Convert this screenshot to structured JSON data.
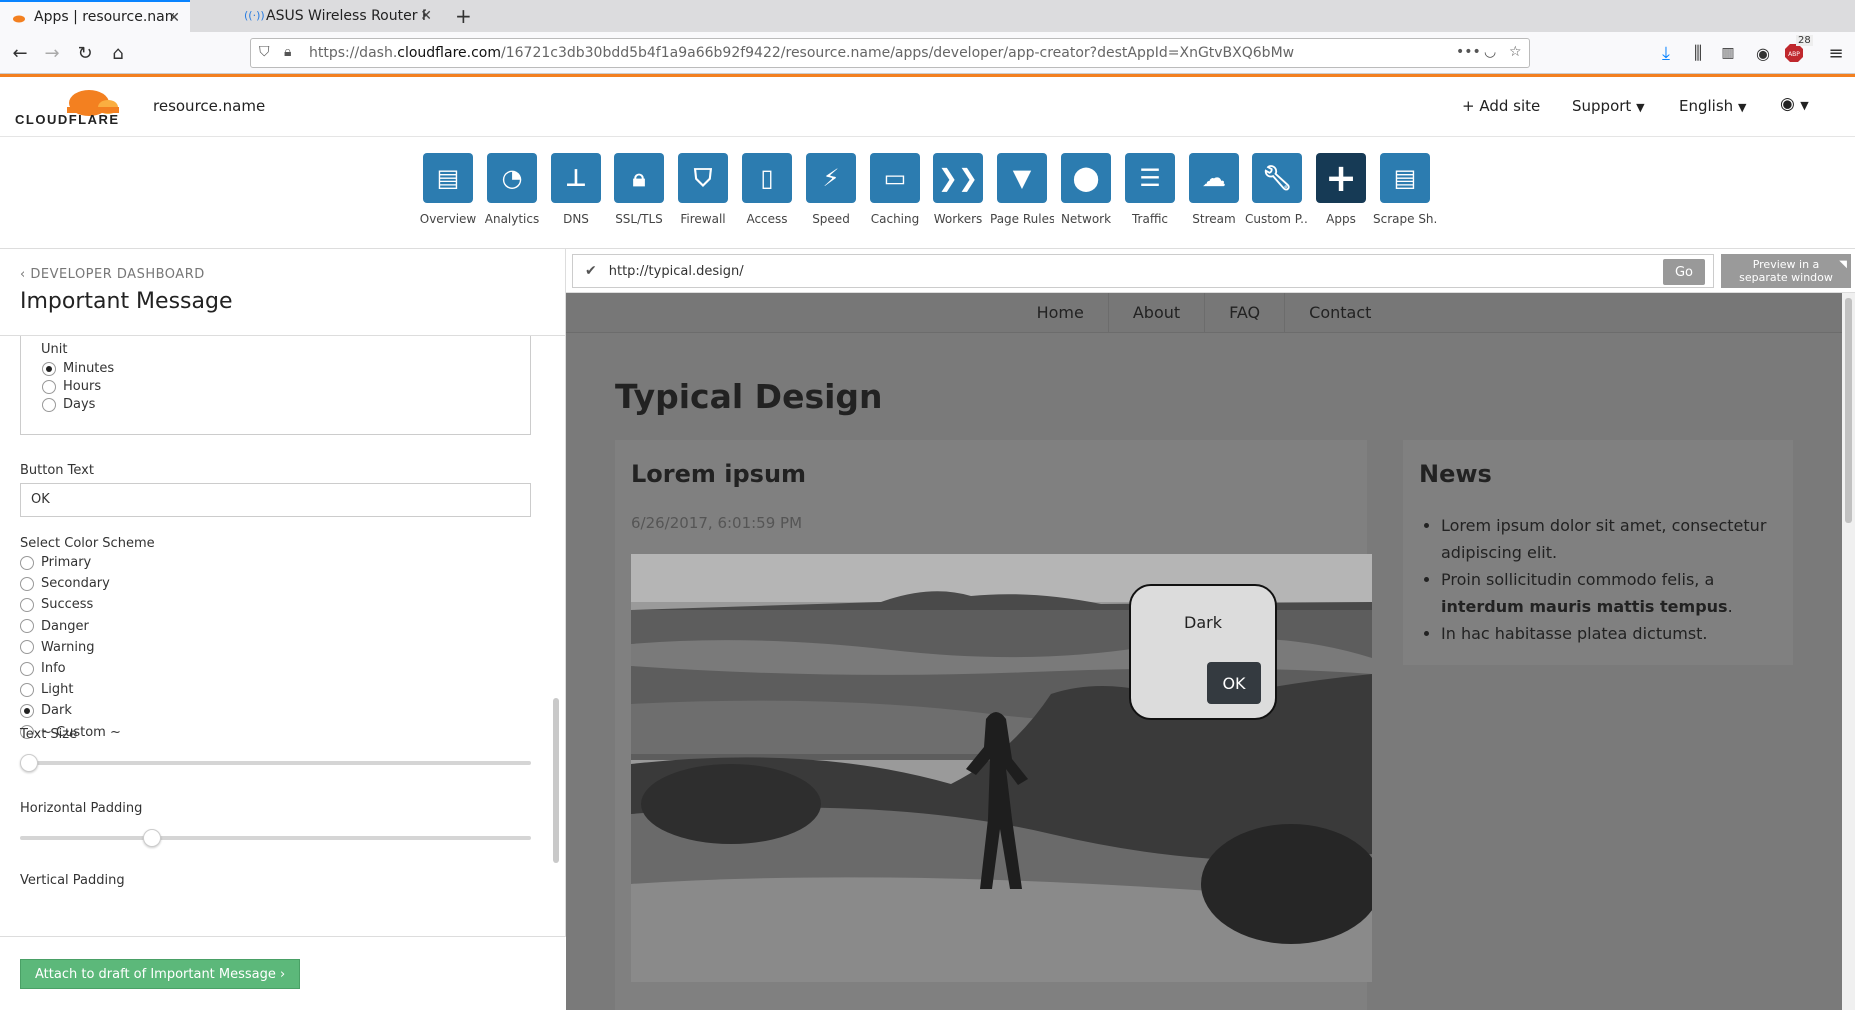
{
  "browser": {
    "tabs": [
      {
        "label": "Apps | resource.name | ⁄"
      },
      {
        "label": "ASUS Wireless Router RT"
      }
    ],
    "url_prefix": "https://dash.",
    "url_host": "cloudflare.com",
    "url_path": "/16721c3db30bdd5b4f1a9a66b92f9422/resource.name/apps/developer/app-creator?destAppId=XnGtvBXQ6bMw",
    "ext_badge": "28"
  },
  "header": {
    "logo_text": "CLOUDFLARE",
    "domain": "resource.name",
    "add_site": "+ Add site",
    "support": "Support",
    "language": "English"
  },
  "apps": [
    {
      "label": "Overview",
      "icon": "clipboard-icon"
    },
    {
      "label": "Analytics",
      "icon": "pie-chart-icon"
    },
    {
      "label": "DNS",
      "icon": "network-tree-icon"
    },
    {
      "label": "SSL/TLS",
      "icon": "lock-icon"
    },
    {
      "label": "Firewall",
      "icon": "shield-icon"
    },
    {
      "label": "Access",
      "icon": "door-icon"
    },
    {
      "label": "Speed",
      "icon": "lightning-icon"
    },
    {
      "label": "Caching",
      "icon": "drive-icon"
    },
    {
      "label": "Workers",
      "icon": "workers-icon"
    },
    {
      "label": "Page Rules",
      "icon": "filter-icon"
    },
    {
      "label": "Network",
      "icon": "location-pin-icon"
    },
    {
      "label": "Traffic",
      "icon": "list-icon"
    },
    {
      "label": "Stream",
      "icon": "cloud-play-icon"
    },
    {
      "label": "Custom P...",
      "icon": "wrench-icon"
    },
    {
      "label": "Apps",
      "icon": "plus-icon"
    },
    {
      "label": "Scrape Sh...",
      "icon": "document-icon"
    }
  ],
  "panel": {
    "breadcrumb": "DEVELOPER DASHBOARD",
    "title": "Important Message",
    "unit_label": "Unit",
    "units": [
      "Minutes",
      "Hours",
      "Days"
    ],
    "unit_selected": "Minutes",
    "button_text_label": "Button Text",
    "button_text_value": "OK",
    "color_scheme_label": "Select Color Scheme",
    "color_schemes": [
      "Primary",
      "Secondary",
      "Success",
      "Danger",
      "Warning",
      "Info",
      "Light",
      "Dark",
      "~ Custom ~"
    ],
    "color_scheme_selected": "Dark",
    "text_size_label": "Text Size",
    "text_size_level": 0,
    "h_padding_label": "Horizontal Padding",
    "h_padding_level": 0.25,
    "v_padding_label": "Vertical Padding",
    "attach_button": "Attach to draft of Important Message ›"
  },
  "preview": {
    "url": "http://typical.design/",
    "go": "Go",
    "separate_window": "Preview in a separate window"
  },
  "site": {
    "nav": [
      "Home",
      "About",
      "FAQ",
      "Contact"
    ],
    "title": "Typical Design",
    "post_title": "Lorem ipsum",
    "post_date": "6/26/2017, 6:01:59 PM",
    "news_title": "News",
    "news_1": "Lorem ipsum dolor sit amet, consectetur adipiscing elit.",
    "news_2_pre": "Proin sollicitudin commodo felis, a ",
    "news_2_bold": "interdum mauris mattis tempus",
    "news_2_post": ".",
    "news_3": "In hac habitasse platea dictumst.",
    "modal_text": "Dark",
    "modal_button": "OK"
  },
  "colors": {
    "accent": "#2c7cb0",
    "active_tile": "#163a55",
    "cf_orange": "#f38020",
    "attach_green": "#5cb87a",
    "dark_button": "#343a40"
  }
}
